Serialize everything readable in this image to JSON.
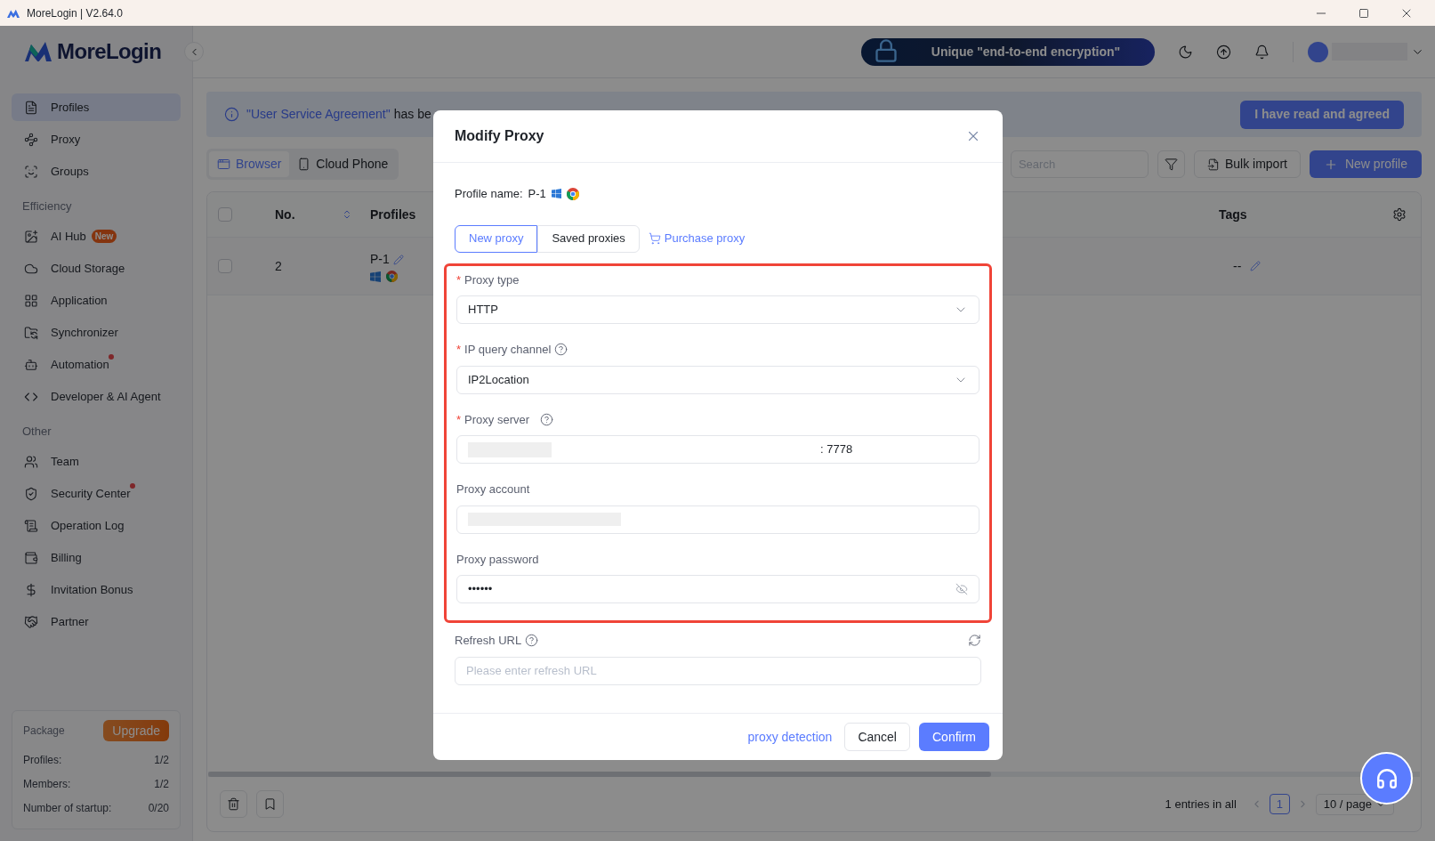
{
  "window": {
    "title": "MoreLogin | V2.64.0"
  },
  "sidebar": {
    "logo": "MoreLogin",
    "sections": [
      {
        "items": [
          {
            "label": "Profiles",
            "selected": true,
            "dot": false
          },
          {
            "label": "Proxy",
            "selected": false,
            "dot": false
          },
          {
            "label": "Groups",
            "selected": false,
            "dot": false
          }
        ]
      },
      {
        "heading": "Efficiency",
        "items": [
          {
            "label": "AI Hub",
            "badge": "New",
            "selected": false,
            "dot": false
          },
          {
            "label": "Cloud Storage",
            "selected": false,
            "dot": false
          },
          {
            "label": "Application",
            "selected": false,
            "dot": false
          },
          {
            "label": "Synchronizer",
            "selected": false,
            "dot": false
          },
          {
            "label": "Automation",
            "selected": false,
            "dot": true
          },
          {
            "label": "Developer & AI Agent",
            "selected": false,
            "dot": false
          }
        ]
      },
      {
        "heading": "Other",
        "items": [
          {
            "label": "Team",
            "selected": false,
            "dot": false
          },
          {
            "label": "Security Center",
            "selected": false,
            "dot": true
          },
          {
            "label": "Operation Log",
            "selected": false,
            "dot": false
          },
          {
            "label": "Billing",
            "selected": false,
            "dot": false
          },
          {
            "label": "Invitation Bonus",
            "selected": false,
            "dot": false
          },
          {
            "label": "Partner",
            "selected": false,
            "dot": false
          }
        ]
      }
    ],
    "package": {
      "title": "Package",
      "upgrade": "Upgrade",
      "rows": [
        {
          "label": "Profiles:",
          "value": "1/2"
        },
        {
          "label": "Members:",
          "value": "1/2"
        },
        {
          "label": "Number of startup:",
          "value": "0/20"
        }
      ]
    }
  },
  "header": {
    "promo": "Unique \"end-to-end encryption\""
  },
  "banner": {
    "link": "\"User Service Agreement\"",
    "text": "has be",
    "button": "I have read and agreed"
  },
  "tabs": [
    {
      "label": "Browser",
      "selected": true
    },
    {
      "label": "Cloud Phone",
      "selected": false
    }
  ],
  "toolbar": {
    "search_placeholder": "Search",
    "bulk_import": "Bulk import",
    "new_profile": "New profile"
  },
  "table": {
    "all_checked": false,
    "columns": [
      "No.",
      "Profiles",
      "Tags"
    ],
    "rows": [
      {
        "checked": false,
        "no": "2",
        "profile": "P-1",
        "tags": "--"
      }
    ]
  },
  "pagination": {
    "total": "1 entries in all",
    "pages": [
      {
        "label": "1",
        "selected": true
      }
    ],
    "page_size": "10 / page"
  },
  "modal": {
    "title": "Modify Proxy",
    "profile_label": "Profile name:",
    "profile_name": "P-1",
    "tabs": [
      {
        "label": "New proxy",
        "selected": true
      },
      {
        "label": "Saved proxies",
        "selected": false
      }
    ],
    "purchase": "Purchase proxy",
    "highlighted_fields": [
      {
        "kind": "select",
        "required_mark": "*",
        "label": "Proxy type",
        "help": false,
        "value": "HTTP"
      },
      {
        "kind": "select",
        "required_mark": "*",
        "label": "IP query channel",
        "help": true,
        "value": "IP2Location"
      },
      {
        "kind": "server",
        "required_mark": "*",
        "label": "Proxy server",
        "help": true,
        "value": ": 7778"
      },
      {
        "kind": "account",
        "label": "Proxy account",
        "help": false
      },
      {
        "kind": "password",
        "label": "Proxy password",
        "help": false,
        "value": "••••••"
      }
    ],
    "fields": [
      {
        "kind": "refresh",
        "label": "Refresh URL",
        "help": true,
        "placeholder": "Please enter refresh URL"
      }
    ],
    "footer": {
      "detection": "proxy detection",
      "cancel": "Cancel",
      "confirm": "Confirm"
    }
  }
}
